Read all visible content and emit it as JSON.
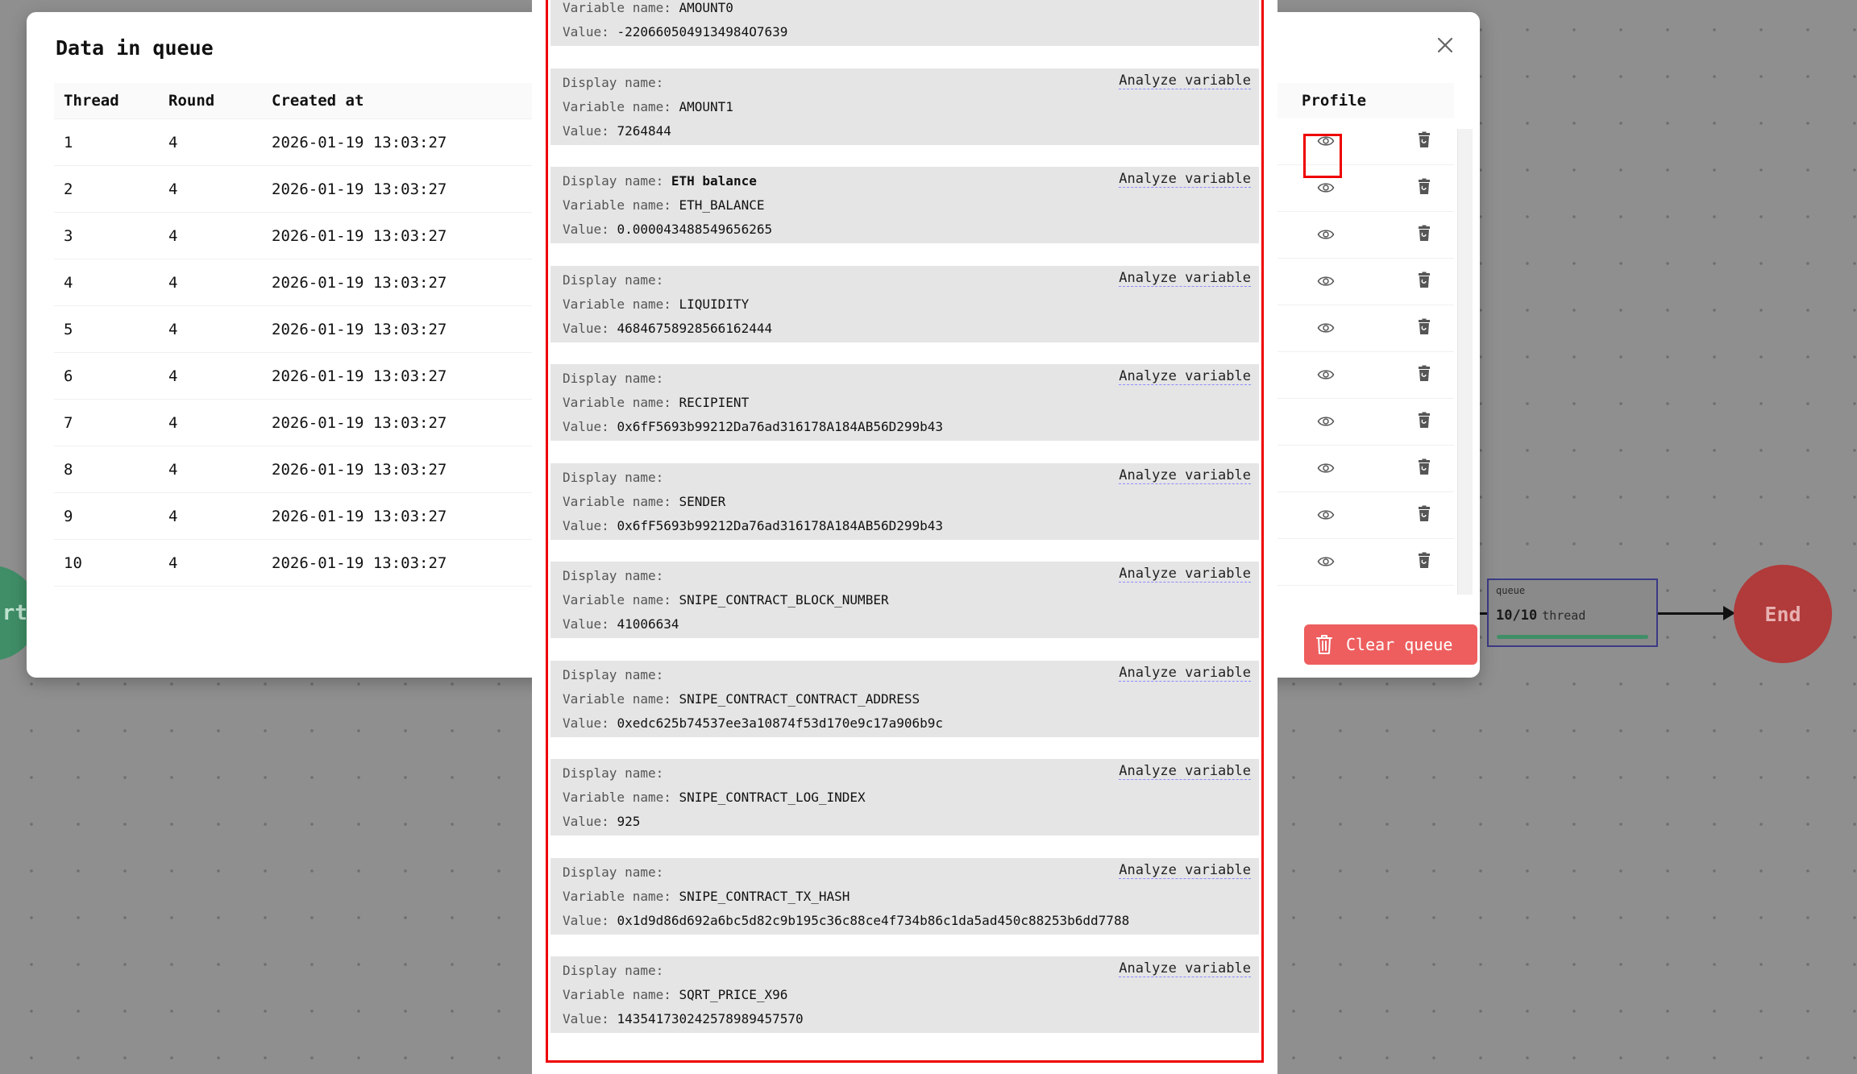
{
  "canvas": {
    "start_label": "rt",
    "end_label": "End",
    "queue_node": {
      "label": "queue",
      "count": "10/10",
      "unit": "thread",
      "progress": 1.0
    }
  },
  "modal": {
    "title": "Data in queue",
    "columns": {
      "thread": "Thread",
      "round": "Round",
      "created_at": "Created at",
      "profile": "Profile"
    },
    "rows": [
      {
        "thread": "1",
        "round": "4",
        "created_at": "2026-01-19 13:03:27"
      },
      {
        "thread": "2",
        "round": "4",
        "created_at": "2026-01-19 13:03:27"
      },
      {
        "thread": "3",
        "round": "4",
        "created_at": "2026-01-19 13:03:27"
      },
      {
        "thread": "4",
        "round": "4",
        "created_at": "2026-01-19 13:03:27"
      },
      {
        "thread": "5",
        "round": "4",
        "created_at": "2026-01-19 13:03:27"
      },
      {
        "thread": "6",
        "round": "4",
        "created_at": "2026-01-19 13:03:27"
      },
      {
        "thread": "7",
        "round": "4",
        "created_at": "2026-01-19 13:03:27"
      },
      {
        "thread": "8",
        "round": "4",
        "created_at": "2026-01-19 13:03:27"
      },
      {
        "thread": "9",
        "round": "4",
        "created_at": "2026-01-19 13:03:27"
      },
      {
        "thread": "10",
        "round": "4",
        "created_at": "2026-01-19 13:03:27"
      }
    ],
    "clear_label": "Clear queue"
  },
  "variables": {
    "display_label": "Display name:",
    "variable_label": "Variable name:",
    "value_label": "Value:",
    "analyze_label": "Analyze variable",
    "items": [
      {
        "display": "",
        "name": "AMOUNT0",
        "value": "-2206605049134984O7639"
      },
      {
        "display": "",
        "name": "AMOUNT1",
        "value": "7264844"
      },
      {
        "display": "ETH balance",
        "name": "ETH_BALANCE",
        "value": "0.000043488549656265"
      },
      {
        "display": "",
        "name": "LIQUIDITY",
        "value": "46846758928566162444"
      },
      {
        "display": "",
        "name": "RECIPIENT",
        "value": "0x6fF5693b99212Da76ad316178A184AB56D299b43"
      },
      {
        "display": "",
        "name": "SENDER",
        "value": "0x6fF5693b99212Da76ad316178A184AB56D299b43"
      },
      {
        "display": "",
        "name": "SNIPE_CONTRACT_BLOCK_NUMBER",
        "value": "41006634"
      },
      {
        "display": "",
        "name": "SNIPE_CONTRACT_CONTRACT_ADDRESS",
        "value": "0xedc625b74537ee3a10874f53d170e9c17a906b9c"
      },
      {
        "display": "",
        "name": "SNIPE_CONTRACT_LOG_INDEX",
        "value": "925"
      },
      {
        "display": "",
        "name": "SNIPE_CONTRACT_TX_HASH",
        "value": "0x1d9d86d692a6bc5d82c9b195c36c88ce4f734b86c1da5ad450c88253b6dd7788"
      },
      {
        "display": "",
        "name": "SQRT_PRICE_X96",
        "value": "143541730242578989457570"
      }
    ]
  },
  "colors": {
    "danger": "#ee5e5e",
    "highlight": "#e00000",
    "progress": "#3f8e67",
    "queue_border": "#3c3a86"
  }
}
